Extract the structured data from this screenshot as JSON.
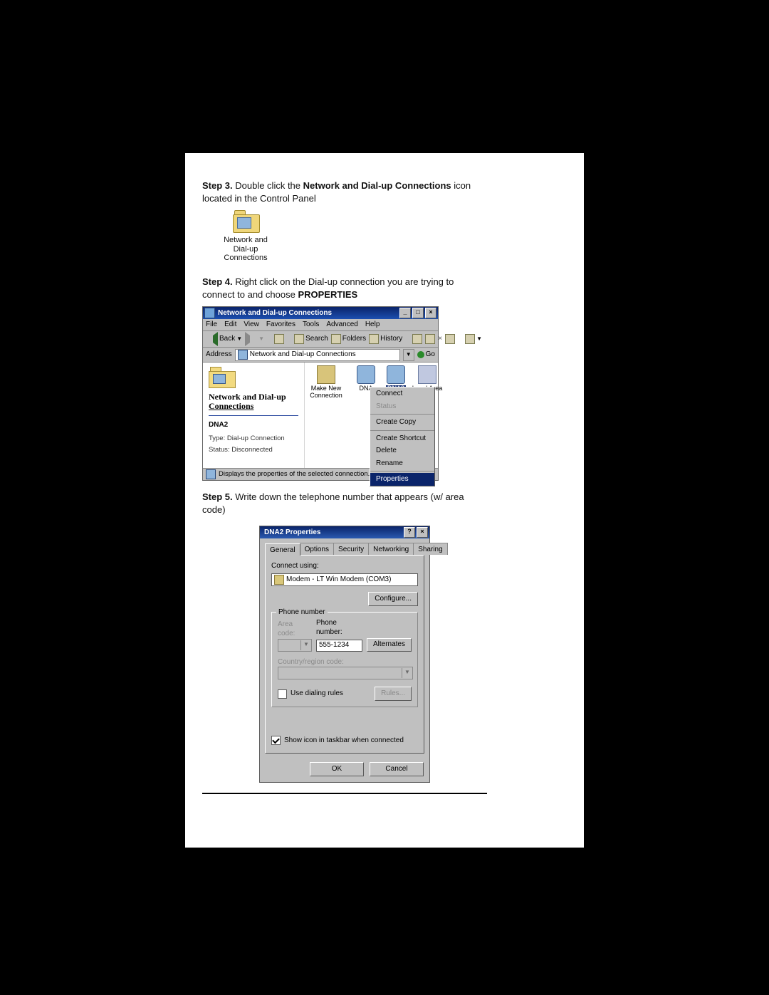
{
  "steps": {
    "s3_label": "Step 3.",
    "s3_text_a": "Double click the ",
    "s3_bold": "Network and Dial-up Connections",
    "s3_text_b": " icon located in the Control Panel",
    "s4_label": "Step 4.",
    "s4_text_a": "Right click on the Dial-up connection you are trying to connect to and choose ",
    "s4_bold": "PROPERTIES",
    "s5_label": "Step 5.",
    "s5_text": "Write down the telephone number that appears (w/ area code)"
  },
  "desktop_icon": {
    "caption": "Network and Dial-up Connections"
  },
  "explorer": {
    "title": "Network and Dial-up Connections",
    "minimize": "_",
    "maximize": "□",
    "close": "×",
    "menu": [
      "File",
      "Edit",
      "View",
      "Favorites",
      "Tools",
      "Advanced",
      "Help"
    ],
    "toolbar": {
      "back": "Back",
      "search": "Search",
      "folders": "Folders",
      "history": "History"
    },
    "address_label": "Address",
    "address_value": "Network and Dial-up Connections",
    "go": "Go",
    "left": {
      "heading1": "Network and Dial-up",
      "heading2": "Connections",
      "selected": "DNA2",
      "type": "Type: Dial-up Connection",
      "status": "Status: Disconnected"
    },
    "icons": {
      "make_new": "Make New Connection",
      "dna": "DNA",
      "dna2": "DNA2",
      "local": "Local Area"
    },
    "context_menu": {
      "connect": "Connect",
      "status": "Status",
      "create_copy": "Create Copy",
      "create_shortcut": "Create Shortcut",
      "delete": "Delete",
      "rename": "Rename",
      "properties": "Properties"
    },
    "statusbar": "Displays the properties of the selected connection."
  },
  "dialog": {
    "title": "DNA2 Properties",
    "help": "?",
    "close": "×",
    "tabs": [
      "General",
      "Options",
      "Security",
      "Networking",
      "Sharing"
    ],
    "connect_using_label": "Connect using:",
    "modem": "Modem - LT Win Modem (COM3)",
    "configure": "Configure...",
    "phone_group": "Phone number",
    "area_code_label": "Area code:",
    "phone_number_label": "Phone number:",
    "phone_number_value": "555-1234",
    "alternates": "Alternates",
    "country_label": "Country/region code:",
    "use_dialing_rules": "Use dialing rules",
    "rules": "Rules...",
    "show_icon": "Show icon in taskbar when connected",
    "ok": "OK",
    "cancel": "Cancel"
  }
}
